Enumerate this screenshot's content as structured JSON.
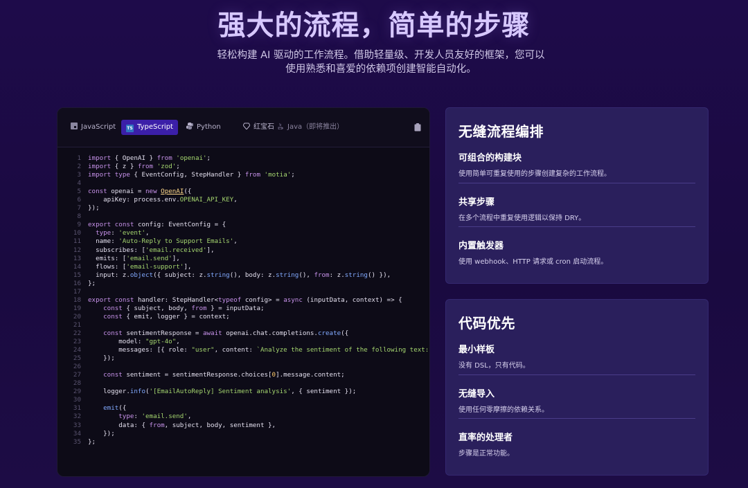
{
  "hero": {
    "title": "强大的流程，简单的步骤",
    "subtitle_line1": "轻松构建 AI 驱动的工作流程。借助轻量级、开发人员友好的框架，您可以",
    "subtitle_line2": "使用熟悉和喜爱的依赖项创建智能自动化。"
  },
  "code_panel": {
    "tabs": [
      {
        "label": "JavaScript",
        "icon": "js-icon",
        "active": false
      },
      {
        "label": "TypeScript",
        "icon": "ts-icon",
        "active": true
      },
      {
        "label": "Python",
        "icon": "python-icon",
        "active": false
      },
      {
        "label": "红宝石",
        "icon": "ruby-icon",
        "active": false
      },
      {
        "label": "Java（即将推出）",
        "icon": "java-icon",
        "active": false
      }
    ],
    "copy_icon": "clipboard-icon",
    "lines": [
      "import { OpenAI } from 'openai';",
      "import { z } from 'zod';",
      "import type { EventConfig, StepHandler } from 'motia';",
      "",
      "const openai = new OpenAI({",
      "    apiKey: process.env.OPENAI_API_KEY,",
      "});",
      "",
      "export const config: EventConfig = {",
      "  type: 'event',",
      "  name: 'Auto-Reply to Support Emails',",
      "  subscribes: ['email.received'],",
      "  emits: ['email.send'],",
      "  flows: ['email-support'],",
      "  input: z.object({ subject: z.string(), body: z.string(), from: z.string() }),",
      "};",
      "",
      "export const handler: StepHandler<typeof config> = async (inputData, context) => {",
      "    const { subject, body, from } = inputData;",
      "    const { emit, logger } = context;",
      "",
      "    const sentimentResponse = await openai.chat.completions.create({",
      "        model: \"gpt-4o\",",
      "        messages: [{ role: \"user\", content: `Analyze the sentiment of the following text: ${",
      "    });",
      "",
      "    const sentiment = sentimentResponse.choices[0].message.content;",
      "",
      "    logger.info('[EmailAutoReply] Sentiment analysis', { sentiment });",
      "",
      "    emit({",
      "        type: 'email.send',",
      "        data: { from, subject, body, sentiment },",
      "    });",
      "};"
    ]
  },
  "cards": [
    {
      "title": "无缝流程编排",
      "features": [
        {
          "title": "可组合的构建块",
          "desc": "使用简单可重复使用的步骤创建复杂的工作流程。"
        },
        {
          "title": "共享步骤",
          "desc": "在多个流程中重复使用逻辑以保持 DRY。"
        },
        {
          "title": "内置触发器",
          "desc": "使用 webhook、HTTP 请求或 cron 启动流程。"
        }
      ]
    },
    {
      "title": "代码优先",
      "features": [
        {
          "title": "最小样板",
          "desc": "没有 DSL，只有代码。"
        },
        {
          "title": "无缝导入",
          "desc": "使用任何零摩擦的依赖关系。"
        },
        {
          "title": "直率的处理者",
          "desc": "步骤是正常功能。"
        }
      ]
    }
  ],
  "colors": {
    "background": "#1e0b4a",
    "card": "#2a1f5c",
    "active_tab": "#3b1fa8",
    "code_bg": "#0d0b17"
  }
}
